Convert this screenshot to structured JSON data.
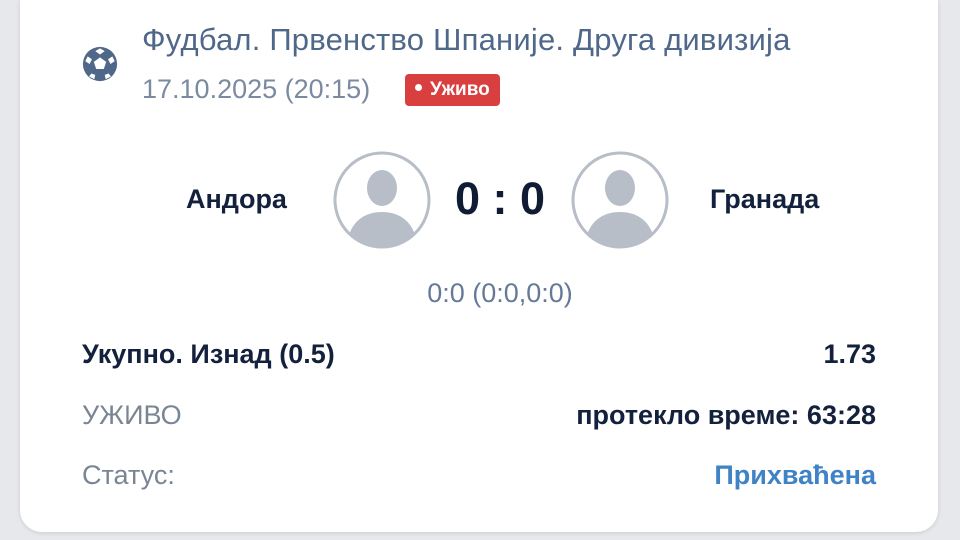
{
  "header": {
    "league_title": "Фудбал. Првенство Шпаније. Друга дивизија",
    "datetime": "17.10.2025 (20:15)",
    "live_badge": "Уживо",
    "sport_icon": "soccer-ball-icon"
  },
  "match": {
    "home_team": "Андора",
    "away_team": "Гранада",
    "score": "0 : 0",
    "score_detail": "0:0 (0:0,0:0)",
    "home_avatar_icon": "user-avatar-icon",
    "away_avatar_icon": "user-avatar-icon"
  },
  "bet": {
    "market": "Укупно. Изнад (0.5)",
    "odds": "1.73"
  },
  "live_row": {
    "label": "УЖИВО",
    "elapsed": "протекло време: 63:28"
  },
  "status_row": {
    "label": "Статус:",
    "value": "Прихваћена"
  },
  "colors": {
    "accent_blue": "#3f82c6",
    "live_red": "#d93f3f",
    "title_slate": "#4f6889",
    "text_dark": "#14213d"
  }
}
